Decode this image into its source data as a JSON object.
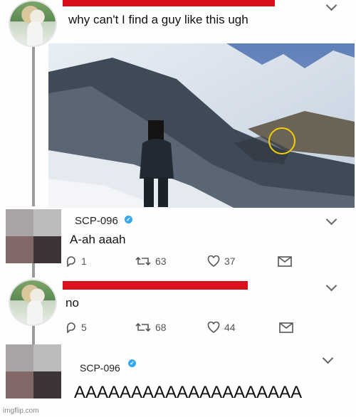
{
  "tweet1": {
    "text": "why can't I find a guy like this ugh"
  },
  "tweet2": {
    "name": "SCP-096",
    "text": "A-ah aaah",
    "replies": "1",
    "retweets": "63",
    "likes": "37"
  },
  "tweet3": {
    "text": "no",
    "replies": "5",
    "retweets": "68",
    "likes": "44"
  },
  "tweet4": {
    "name": "SCP-096",
    "text": "AAAAAAAAAAAAAAAAAAAA"
  },
  "watermark": "imgflip.com",
  "colors": {
    "redaction": "#d8101c",
    "verified": "#35a8f0",
    "thread_line": "#9b9b9b"
  }
}
